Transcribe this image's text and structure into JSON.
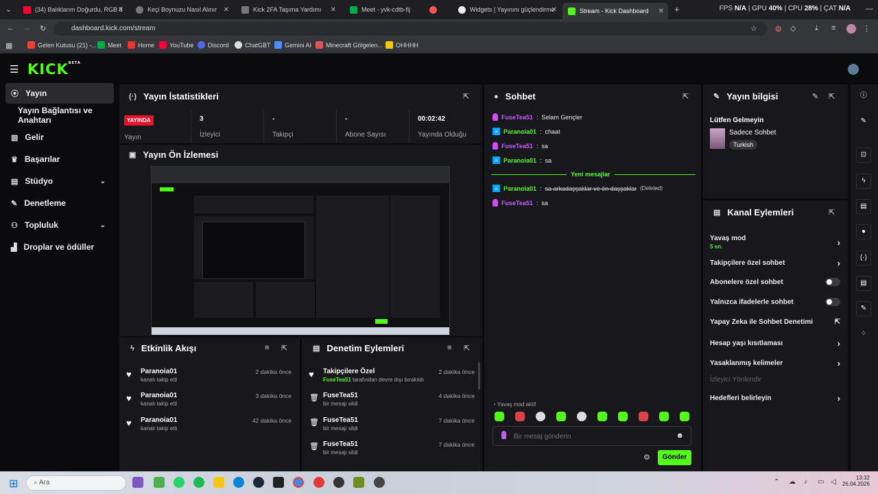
{
  "browser": {
    "tabs": [
      {
        "label": "(34) Balıklarım Doğurdu, RGB 8",
        "color": "#ff0033"
      },
      {
        "label": "Keçi Boynuzu Nasıl Alınır",
        "color": "#cccccc"
      },
      {
        "label": "Kick 2FA Taşıma Yardımı",
        "color": "#cccccc"
      },
      {
        "label": "Meet - yvk-cdtb-fij",
        "color": "#00ac47"
      },
      {
        "label": "Widgets | Yayınını güçlendirme",
        "color": "#ff5555"
      },
      {
        "label": "Stream - Kick Dashboard",
        "color": "#53fc18"
      }
    ],
    "new_tab": "+",
    "perf": {
      "fps_label": "FPS",
      "fps": "N/A",
      "gpu_label": "GPU",
      "gpu": "40%",
      "cpu_label": "CPU",
      "cpu": "28%",
      "cat_label": "ÇAT",
      "cat": "N/A"
    },
    "url": "dashboard.kick.com/stream",
    "bookmarks": [
      "Gelen Kutusu (21) -...",
      "Meet",
      "Home",
      "YouTube",
      "Discord",
      "ChatGBT",
      "Gemini AI",
      "Minecraft Gölgelen...",
      "OHHHH"
    ]
  },
  "app": {
    "logo": "KICK",
    "logo_sup": "BETA",
    "nav": [
      {
        "label": "Yayın"
      },
      {
        "label": "Yayın Bağlantısı ve Anahtarı"
      },
      {
        "label": "Gelir"
      },
      {
        "label": "Başarılar"
      },
      {
        "label": "Stüdyo"
      },
      {
        "label": "Denetleme"
      },
      {
        "label": "Topluluk"
      },
      {
        "label": "Droplar ve ödüller"
      }
    ],
    "stats": {
      "title": "Yayın İstatistikleri",
      "live_badge": "YAYINDA",
      "cells": [
        {
          "label": "Yayın",
          "value": ""
        },
        {
          "label": "İzleyici",
          "value": "3"
        },
        {
          "label": "Takipçi",
          "value": "-"
        },
        {
          "label": "Abone Sayısı",
          "value": "-"
        },
        {
          "label": "Yayında Olduğu",
          "value": "00:02:42"
        }
      ]
    },
    "preview": {
      "title": "Yayın Ön İzlemesi"
    },
    "activity": {
      "title": "Etkinlik Akışı",
      "items": [
        {
          "name": "Paranoia01",
          "sub": "kanalı takip etti",
          "time": "2 dakika önce"
        },
        {
          "name": "Paranoia01",
          "sub": "kanalı takip etti",
          "time": "3 dakika önce"
        },
        {
          "name": "Paranoia01",
          "sub": "kanalı takip etti",
          "time": "42 dakika önce"
        }
      ]
    },
    "modlog": {
      "title": "Denetim Eylemleri",
      "items": [
        {
          "name": "Takipçilere Özel",
          "who": "FuseTea51",
          "sub": "tarafından devre dışı bırakıldı",
          "time": "2 dakika önce"
        },
        {
          "name": "FuseTea51",
          "who": "",
          "sub": "bir mesajı sildi",
          "time": "4 dakika önce"
        },
        {
          "name": "FuseTea51",
          "who": "",
          "sub": "bir mesajı sildi",
          "time": "7 dakika önce"
        },
        {
          "name": "FuseTea51",
          "who": "",
          "sub": "bir mesajı sildi",
          "time": "7 dakika önce"
        }
      ]
    },
    "chat": {
      "title": "Sohbet",
      "messages": [
        {
          "user": "FuseTea51",
          "text": "Selam Gençler",
          "badge": "vip"
        },
        {
          "user": "Paranoia01",
          "text": "chaat",
          "badge": "mod"
        },
        {
          "user": "FuseTea51",
          "text": "sa",
          "badge": "vip"
        },
        {
          "user": "Paranoia01",
          "text": "sa",
          "badge": "mod"
        }
      ],
      "new_messages": "Yeni mesajlar",
      "messages2": [
        {
          "user": "Paranoia01",
          "text": "sa arkadaşşaklar ve ön daşşaklar",
          "deleted": "(Deleted)",
          "badge": "mod"
        },
        {
          "user": "FuseTea51",
          "text": "sa",
          "badge": "vip"
        }
      ],
      "slow_mode": "Yavaş mod aktif",
      "placeholder": "Bir mesaj gönderin",
      "send": "Gönder"
    },
    "stream_info": {
      "title": "Yayın bilgisi",
      "stream_title": "Lütfen Gelmeyin",
      "category": "Sadece Sohbet",
      "tag": "Turkish"
    },
    "channel_actions": {
      "title": "Kanal Eylemleri",
      "items": [
        {
          "label": "Yavaş mod",
          "sub": "5 sn.",
          "control": "chevron"
        },
        {
          "label": "Takipçilere özel sohbet",
          "sub": "",
          "control": "chevron"
        },
        {
          "label": "Abonelere özel sohbet",
          "sub": "",
          "control": "toggle"
        },
        {
          "label": "Yalnızca ifadelerle sohbet",
          "sub": "",
          "control": "toggle"
        },
        {
          "label": "Yapay Zeka ile Sohbet Denetimi",
          "sub": "",
          "control": "external"
        },
        {
          "label": "Hesap yaşı kısıtlaması",
          "sub": "",
          "control": "chevron"
        },
        {
          "label": "Yasaklanmış kelimeler",
          "sub": "",
          "control": "chevron"
        },
        {
          "label": "İzleyici Yönlendir",
          "sub": "",
          "control": "none",
          "disabled": true
        },
        {
          "label": "Hedefleri belirleyin",
          "sub": "",
          "control": "chevron"
        }
      ]
    }
  },
  "taskbar": {
    "search": "Ara",
    "time": "13:32",
    "date": "26.04.2026"
  }
}
